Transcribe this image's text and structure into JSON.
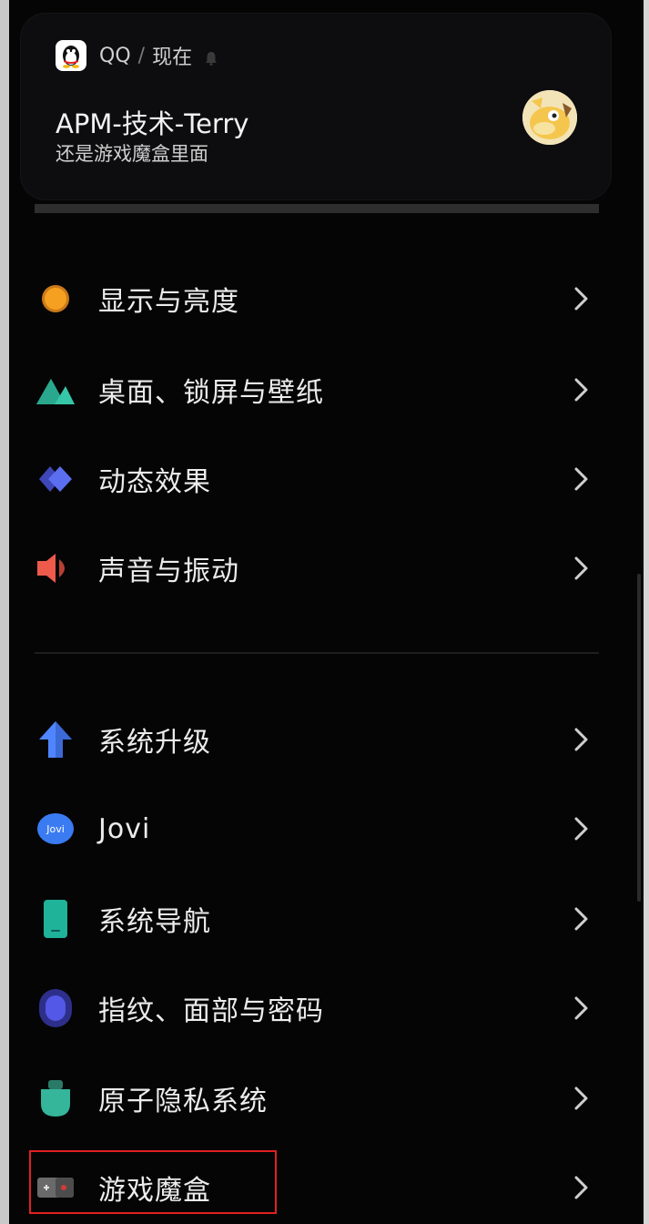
{
  "notification": {
    "app": "QQ",
    "separator": "/",
    "time": "现在",
    "title": "APM-技术-Terry",
    "message": "还是游戏魔盒里面"
  },
  "settings": {
    "items": [
      {
        "label": "显示与亮度",
        "icon": "display-brightness-icon"
      },
      {
        "label": "桌面、锁屏与壁纸",
        "icon": "wallpaper-icon"
      },
      {
        "label": "动态效果",
        "icon": "animation-icon"
      },
      {
        "label": "声音与振动",
        "icon": "sound-icon"
      },
      {
        "label": "系统升级",
        "icon": "system-update-icon"
      },
      {
        "label": "Jovi",
        "icon": "jovi-icon"
      },
      {
        "label": "系统导航",
        "icon": "system-navigation-icon"
      },
      {
        "label": "指纹、面部与密码",
        "icon": "fingerprint-icon"
      },
      {
        "label": "原子隐私系统",
        "icon": "privacy-icon"
      },
      {
        "label": "游戏魔盒",
        "icon": "game-box-icon"
      }
    ],
    "jovi_icon_text": "Jovi"
  },
  "colors": {
    "background": "#050505",
    "highlight_border": "#e02020",
    "display_icon": "#f5a020",
    "wallpaper_icon": "#36c7a8",
    "animation_icon": "#5b6ef0",
    "sound_icon": "#ee5a4b",
    "update_icon": "#4f86ff",
    "jovi_icon": "#3a7bf2",
    "navigation_icon": "#1fb39a",
    "fingerprint_icon": "#5358e6",
    "privacy_icon": "#35b59a"
  }
}
